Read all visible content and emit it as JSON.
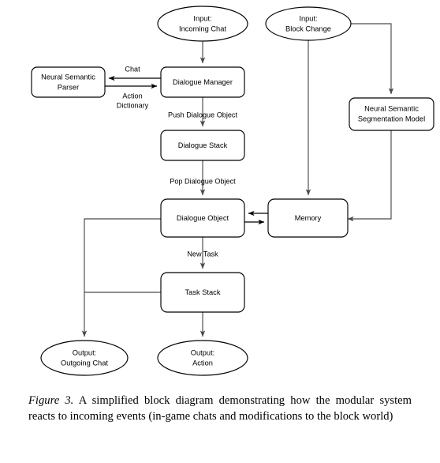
{
  "figure": {
    "label": "Figure 3.",
    "caption_text": " A simplified block diagram demonstrating how the modular system reacts to incoming events (in-game chats and modifications to the block world)"
  },
  "diagram": {
    "type": "flowchart",
    "title": "Modular system event-reaction block diagram",
    "colors": {
      "node_fill": "#ffffff",
      "node_stroke": "#000000",
      "edge_stroke": "#4a4a4a",
      "text": "#000000",
      "background": "#ffffff"
    },
    "nodes": [
      {
        "id": "input_chat",
        "shape": "ellipse",
        "lines": [
          "Input:",
          "Incoming Chat"
        ]
      },
      {
        "id": "input_block",
        "shape": "ellipse",
        "lines": [
          "Input:",
          "Block Change"
        ]
      },
      {
        "id": "parser",
        "shape": "rounded-rect",
        "lines": [
          "Neural Semantic",
          "Parser"
        ]
      },
      {
        "id": "dialogue_mgr",
        "shape": "rounded-rect",
        "lines": [
          "Dialogue Manager"
        ]
      },
      {
        "id": "seg_model",
        "shape": "rounded-rect",
        "lines": [
          "Neural Semantic",
          "Segmentation Model"
        ]
      },
      {
        "id": "dialogue_stack",
        "shape": "rounded-rect",
        "lines": [
          "Dialogue Stack"
        ]
      },
      {
        "id": "dialogue_obj",
        "shape": "rounded-rect",
        "lines": [
          "Dialogue Object"
        ]
      },
      {
        "id": "memory",
        "shape": "rounded-rect",
        "lines": [
          "Memory"
        ]
      },
      {
        "id": "task_stack",
        "shape": "rounded-rect",
        "lines": [
          "Task Stack"
        ]
      },
      {
        "id": "output_chat",
        "shape": "ellipse",
        "lines": [
          "Output:",
          "Outgoing Chat"
        ]
      },
      {
        "id": "output_action",
        "shape": "ellipse",
        "lines": [
          "Output:",
          "Action"
        ]
      }
    ],
    "edges": [
      {
        "id": "e1",
        "from": "input_chat",
        "to": "dialogue_mgr",
        "label": ""
      },
      {
        "id": "e2",
        "from": "dialogue_mgr",
        "to": "parser",
        "label": "Chat"
      },
      {
        "id": "e3",
        "from": "parser",
        "to": "dialogue_mgr",
        "label_line1": "Action",
        "label_line2": "Dictionary"
      },
      {
        "id": "e4",
        "from": "dialogue_mgr",
        "to": "dialogue_stack",
        "label": "Push Dialogue Object"
      },
      {
        "id": "e5",
        "from": "dialogue_stack",
        "to": "dialogue_obj",
        "label": "Pop Dialogue Object"
      },
      {
        "id": "e6",
        "from": "memory",
        "to": "dialogue_obj",
        "label": ""
      },
      {
        "id": "e7",
        "from": "dialogue_obj",
        "to": "memory",
        "label": ""
      },
      {
        "id": "e8",
        "from": "input_block",
        "to": "memory",
        "label": ""
      },
      {
        "id": "e9",
        "from": "input_block",
        "to": "seg_model",
        "label": ""
      },
      {
        "id": "e10",
        "from": "seg_model",
        "to": "memory",
        "label": ""
      },
      {
        "id": "e11",
        "from": "dialogue_obj",
        "to": "task_stack",
        "label": "New Task"
      },
      {
        "id": "e12",
        "from": "dialogue_obj",
        "to": "output_chat",
        "label": ""
      },
      {
        "id": "e13",
        "from": "task_stack",
        "to": "output_chat",
        "label": ""
      },
      {
        "id": "e14",
        "from": "task_stack",
        "to": "output_action",
        "label": ""
      }
    ],
    "labels": {
      "input_chat_l1": "Input:",
      "input_chat_l2": "Incoming Chat",
      "input_block_l1": "Input:",
      "input_block_l2": "Block Change",
      "parser_l1": "Neural Semantic",
      "parser_l2": "Parser",
      "dialogue_mgr": "Dialogue Manager",
      "seg_model_l1": "Neural Semantic",
      "seg_model_l2": "Segmentation Model",
      "dialogue_stack": "Dialogue Stack",
      "dialogue_obj": "Dialogue Object",
      "memory": "Memory",
      "task_stack": "Task Stack",
      "output_chat_l1": "Output:",
      "output_chat_l2": "Outgoing Chat",
      "output_action_l1": "Output:",
      "output_action_l2": "Action",
      "edge_chat": "Chat",
      "edge_action_1": "Action",
      "edge_action_2": "Dictionary",
      "edge_push": "Push Dialogue Object",
      "edge_pop": "Pop Dialogue Object",
      "edge_new_task": "New Task"
    }
  }
}
